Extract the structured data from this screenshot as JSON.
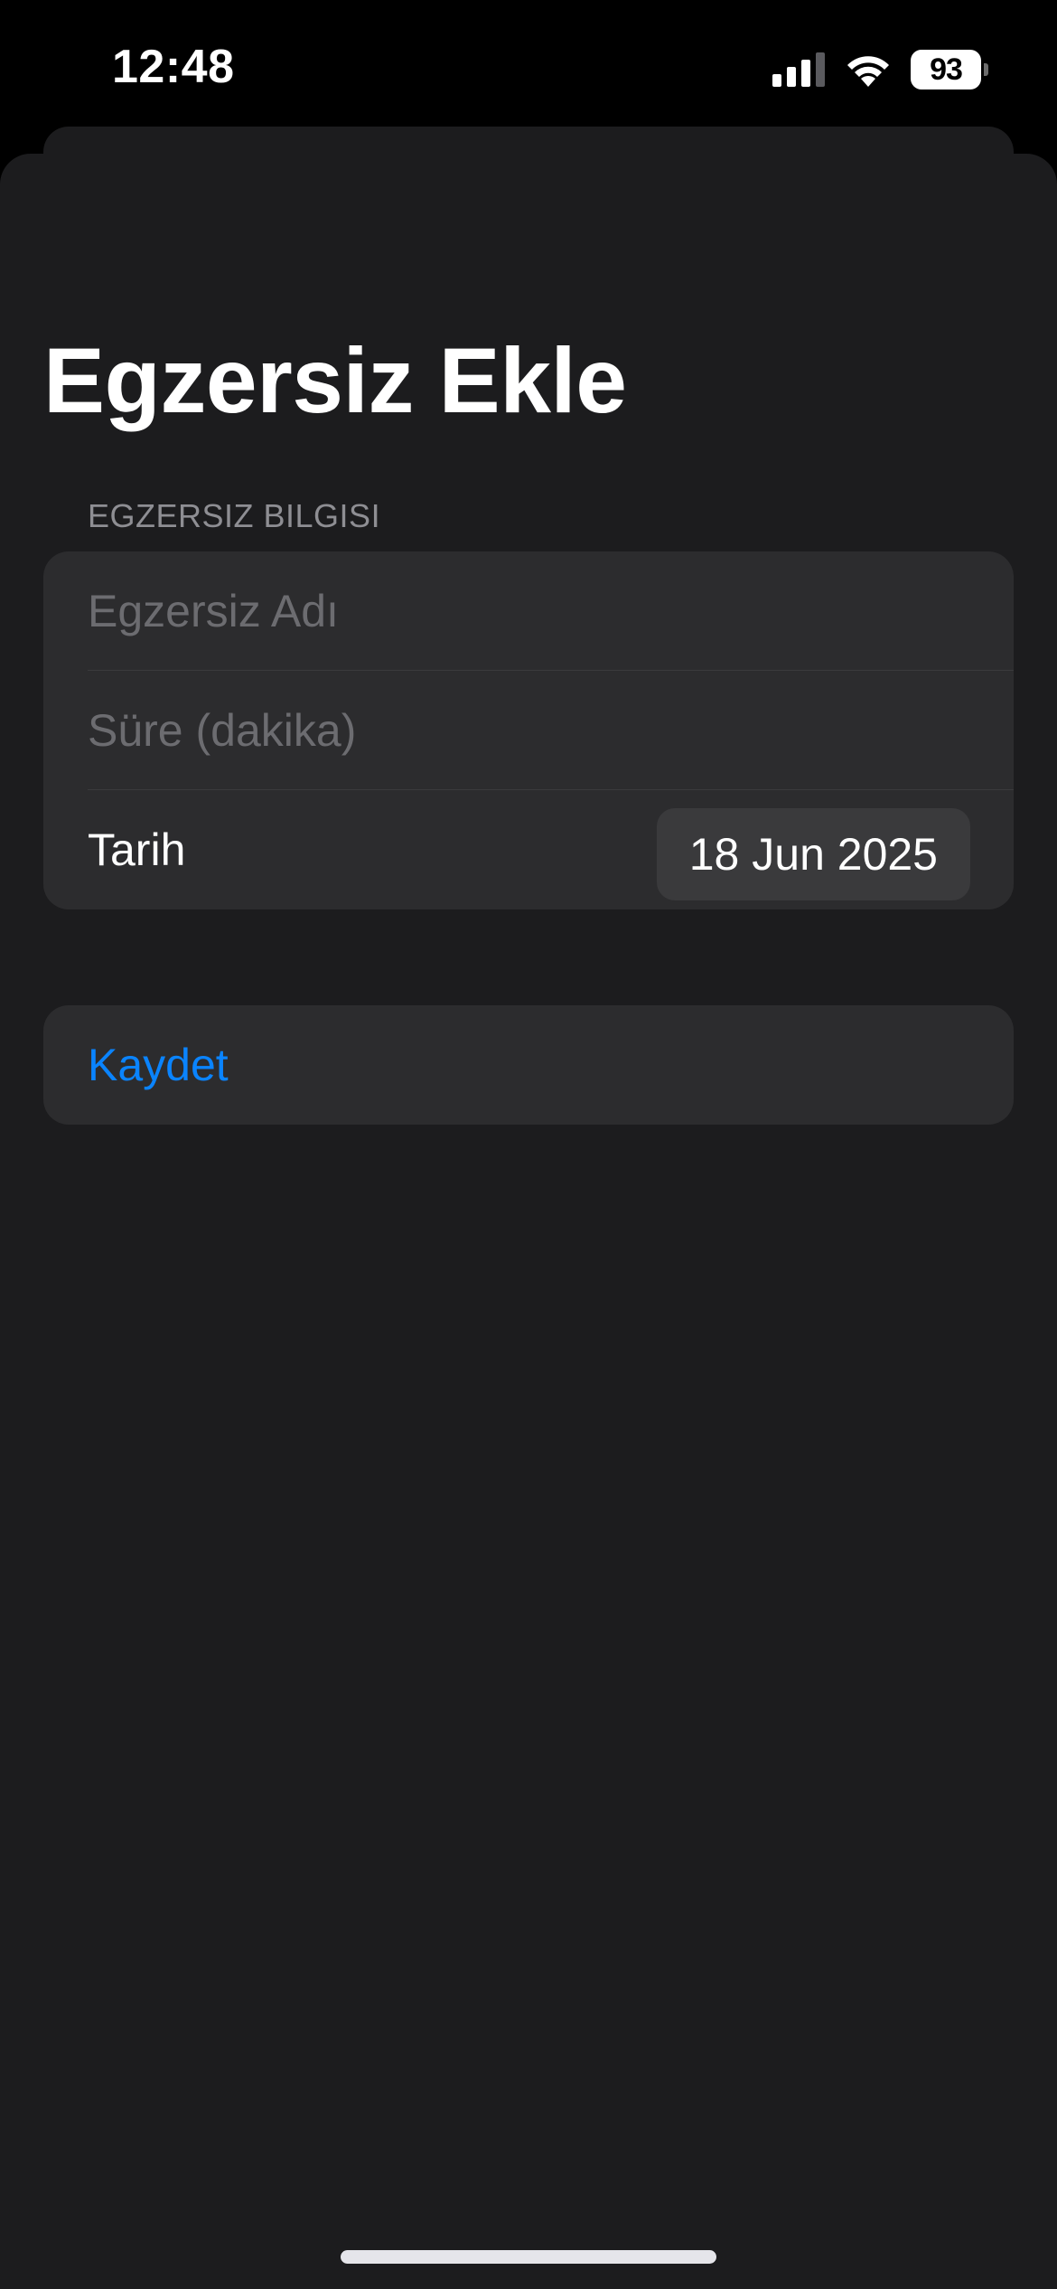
{
  "status_bar": {
    "time": "12:48",
    "battery": "93"
  },
  "page": {
    "title": "Egzersiz Ekle"
  },
  "form": {
    "section_header": "EGZERSIZ BILGISI",
    "name_field": {
      "placeholder": "Egzersiz Adı",
      "value": ""
    },
    "duration_field": {
      "placeholder": "Süre (dakika)",
      "value": ""
    },
    "date_row": {
      "label": "Tarih",
      "value": "18 Jun 2025"
    }
  },
  "actions": {
    "save_label": "Kaydet"
  },
  "colors": {
    "background": "#000000",
    "sheet": "#1c1c1e",
    "card": "#2c2c2e",
    "accent": "#0a84ff",
    "placeholder": "#6c6c70",
    "secondary_text": "#8e8e93"
  },
  "icons": [
    "signal-icon",
    "wifi-icon",
    "battery-icon"
  ]
}
